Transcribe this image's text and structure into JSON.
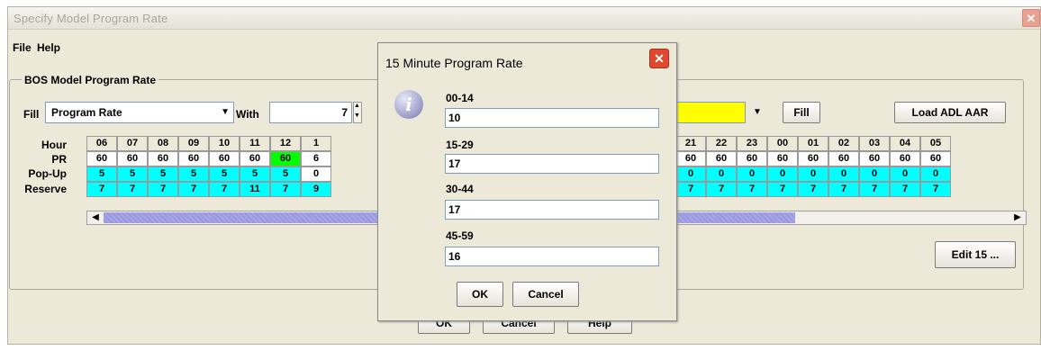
{
  "window": {
    "title": "Specify Model Program Rate",
    "close": "✕"
  },
  "menus": [
    "File",
    "Help"
  ],
  "group_title": "BOS Model Program Rate",
  "fill_label": "Fill",
  "fill_select": "Program Rate",
  "with_label": "With",
  "with_value": "7",
  "fill_button": "Fill",
  "load_button": "Load ADL AAR",
  "edit_button": "Edit 15 ...",
  "row_labels": [
    "Hour",
    "PR",
    "Pop-Up",
    "Reserve"
  ],
  "left_hours": [
    "06",
    "07",
    "08",
    "09",
    "10",
    "11",
    "12",
    "1"
  ],
  "left_pr": [
    "60",
    "60",
    "60",
    "60",
    "60",
    "60",
    "60",
    "6"
  ],
  "left_popup": [
    "5",
    "5",
    "5",
    "5",
    "5",
    "5",
    "5",
    "0"
  ],
  "left_reserve": [
    "7",
    "7",
    "7",
    "7",
    "7",
    "11",
    "7",
    "9"
  ],
  "right_hours": [
    "21",
    "22",
    "23",
    "00",
    "01",
    "02",
    "03",
    "04",
    "05"
  ],
  "right_pr": [
    "60",
    "60",
    "60",
    "60",
    "60",
    "60",
    "60",
    "60",
    "60"
  ],
  "right_popup": [
    "0",
    "0",
    "0",
    "0",
    "0",
    "0",
    "0",
    "0",
    "0"
  ],
  "right_reserve": [
    "7",
    "7",
    "7",
    "7",
    "7",
    "7",
    "7",
    "7",
    "7"
  ],
  "bottom_buttons": [
    "OK",
    "Cancel",
    "Help"
  ],
  "dialog": {
    "title": "15 Minute Program Rate",
    "close": "✕",
    "fields": [
      {
        "label": "00-14",
        "value": "10"
      },
      {
        "label": "15-29",
        "value": "17"
      },
      {
        "label": "30-44",
        "value": "17"
      },
      {
        "label": "45-59",
        "value": "16"
      }
    ],
    "ok": "OK",
    "cancel": "Cancel"
  },
  "colors": {
    "reserve_bg": "#00ffff",
    "highlight_pr": "#00ff00",
    "yellow_field": "#ffff00"
  }
}
